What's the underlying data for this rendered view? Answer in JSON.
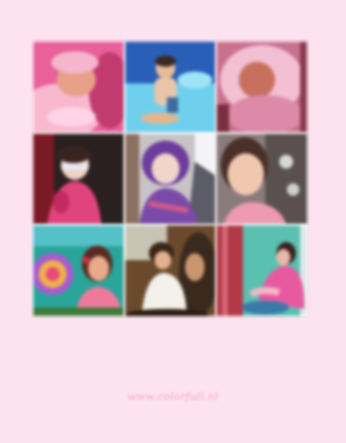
{
  "collage": {
    "photos": [
      {
        "subject": "baby sleeping in pink blanket",
        "palette": [
          "#e9609a",
          "#f8b9cf",
          "#c13b6e"
        ]
      },
      {
        "subject": "toddler sitting in blue pool",
        "palette": [
          "#2f6fc6",
          "#7fd4f0",
          "#f2c9a6"
        ]
      },
      {
        "subject": "baby in pink hooded blanket",
        "palette": [
          "#d9789a",
          "#f6c6d8",
          "#8a3a4f"
        ]
      },
      {
        "subject": "girl with sunglasses in pink jacket",
        "palette": [
          "#2a2020",
          "#e0447c",
          "#f4d6c8"
        ]
      },
      {
        "subject": "child in purple hooded jacket",
        "palette": [
          "#7a4aa8",
          "#e6c8b8",
          "#c8c8d0"
        ]
      },
      {
        "subject": "smiling girl in pink top",
        "palette": [
          "#e8a0b4",
          "#f0c8b0",
          "#6a5a5a"
        ]
      },
      {
        "subject": "girl with colorful ball",
        "palette": [
          "#2aa59a",
          "#ee7a9a",
          "#a85bd0"
        ]
      },
      {
        "subject": "girl in white shirt indoors",
        "palette": [
          "#6b4a2c",
          "#f4f0ea",
          "#b77a4a"
        ]
      },
      {
        "subject": "girl in pink by window",
        "palette": [
          "#b23a48",
          "#5ac0b0",
          "#e85aa0"
        ]
      }
    ]
  },
  "watermark": {
    "text": "www.colorfull.nl"
  },
  "colors": {
    "background": "#fde3f0",
    "frame": "#ffffff",
    "watermark": "#f7a7bd"
  }
}
